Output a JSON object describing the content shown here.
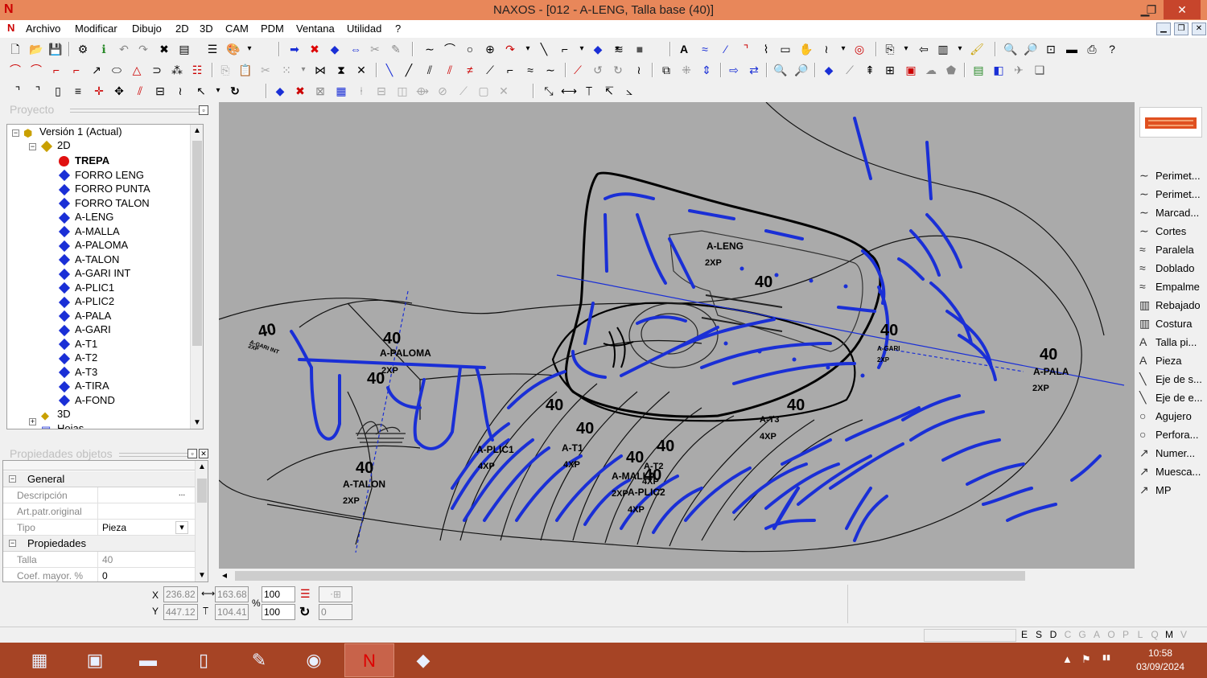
{
  "window": {
    "title": "NAXOS - [012 - A-LENG, Talla base (40)]",
    "app_icon": "N",
    "controls": {
      "minimize": "▁",
      "maximize": "❐",
      "close": "✕"
    }
  },
  "menu": {
    "items": [
      "Archivo",
      "Modificar",
      "Dibujo",
      "2D",
      "3D",
      "CAM",
      "PDM",
      "Ventana",
      "Utilidad",
      "?"
    ],
    "mdi_controls": [
      "▁",
      "❐",
      "✕"
    ]
  },
  "project_panel": {
    "title": "Proyecto",
    "root": "Versión 1 (Actual)",
    "node_2d": "2D",
    "items": [
      {
        "label": "TREPA",
        "bold": true,
        "color": "#e01010"
      },
      {
        "label": "FORRO LENG"
      },
      {
        "label": "FORRO PUNTA"
      },
      {
        "label": "FORRO TALON"
      },
      {
        "label": "A-LENG"
      },
      {
        "label": "A-MALLA"
      },
      {
        "label": "A-PALOMA"
      },
      {
        "label": "A-TALON"
      },
      {
        "label": "A-GARI INT"
      },
      {
        "label": "A-PLIC1"
      },
      {
        "label": "A-PLIC2"
      },
      {
        "label": "A-PALA"
      },
      {
        "label": "A-GARI"
      },
      {
        "label": "A-T1"
      },
      {
        "label": "A-T2"
      },
      {
        "label": "A-T3"
      },
      {
        "label": "A-TIRA"
      },
      {
        "label": "A-FOND"
      }
    ],
    "node_3d": "3D",
    "node_hojas": "Hojas"
  },
  "properties_panel": {
    "title": "Propiedades objetos",
    "groups": [
      {
        "name": "General",
        "rows": [
          {
            "key": "Descripción",
            "value": "",
            "button": "..."
          },
          {
            "key": "Art.patr.original",
            "value": ""
          },
          {
            "key": "Tipo",
            "value": "Pieza",
            "dropdown": "▾"
          }
        ]
      },
      {
        "name": "Propiedades",
        "rows": [
          {
            "key": "Talla",
            "value": "40"
          },
          {
            "key": "Coef. mayor. %",
            "value": "0"
          }
        ]
      }
    ]
  },
  "canvas_labels": [
    {
      "name": "A-LENG",
      "sub": "2XP",
      "size": "40"
    },
    {
      "name": "A-PALOMA",
      "sub": "2XP",
      "size": "40"
    },
    {
      "name": "A-TALON",
      "sub": "2XP",
      "size": "40"
    },
    {
      "name": "A-PLIC1",
      "sub": "4XP",
      "size": "40"
    },
    {
      "name": "A-T1",
      "sub": "4XP",
      "size": "40"
    },
    {
      "name": "A-MALLA",
      "sub": "2XP",
      "size": "40"
    },
    {
      "name": "A-PLIC2",
      "sub": "4XP",
      "size": "40"
    },
    {
      "name": "A-T2",
      "sub": "4XP",
      "size": "40"
    },
    {
      "name": "A-T3",
      "sub": "4XP",
      "size": "40"
    },
    {
      "name": "A-GARI",
      "sub": "2XP",
      "size": "40"
    },
    {
      "name": "A-PALA",
      "sub": "2XP",
      "size": "40"
    },
    {
      "name": "A-GARI INT",
      "sub": "2XP",
      "size": "40"
    }
  ],
  "right_tools": [
    {
      "icon": "curve-icon",
      "glyph": "∼",
      "label": "Perimet..."
    },
    {
      "icon": "curve-icon",
      "glyph": "∼",
      "label": "Perimet..."
    },
    {
      "icon": "curve-icon",
      "glyph": "∼",
      "label": "Marcad..."
    },
    {
      "icon": "curve-icon",
      "glyph": "∼",
      "label": "Cortes"
    },
    {
      "icon": "parallel-icon",
      "glyph": "≈",
      "label": "Paralela"
    },
    {
      "icon": "fold-icon",
      "glyph": "≈",
      "label": "Doblado"
    },
    {
      "icon": "join-icon",
      "glyph": "≈",
      "label": "Empalme"
    },
    {
      "icon": "skive-icon",
      "glyph": "▥",
      "label": "Rebajado"
    },
    {
      "icon": "stitch-icon",
      "glyph": "▥",
      "label": "Costura"
    },
    {
      "icon": "text-icon",
      "glyph": "A",
      "label": "Talla pi..."
    },
    {
      "icon": "text-icon",
      "glyph": "A",
      "label": "Pieza"
    },
    {
      "icon": "axis-icon",
      "glyph": "╲",
      "label": "Eje de s..."
    },
    {
      "icon": "axis-icon",
      "glyph": "╲",
      "label": "Eje de e..."
    },
    {
      "icon": "hole-icon",
      "glyph": "○",
      "label": "Agujero"
    },
    {
      "icon": "punch-icon",
      "glyph": "○",
      "label": "Perfora..."
    },
    {
      "icon": "number-icon",
      "glyph": "↗",
      "label": "Numer..."
    },
    {
      "icon": "notch-icon",
      "glyph": "↗",
      "label": "Muesca..."
    },
    {
      "icon": "mp-icon",
      "glyph": "↗",
      "label": "MP"
    }
  ],
  "coords": {
    "x_label": "X",
    "y_label": "Y",
    "x": "236.82",
    "y": "447.12",
    "width": "163.68",
    "height": "104.41",
    "scale_x": "100",
    "scale_y": "100",
    "percent": "%",
    "angle": "0"
  },
  "status_flags": [
    {
      "label": "E",
      "on": true
    },
    {
      "label": "S",
      "on": true
    },
    {
      "label": "D",
      "on": true
    },
    {
      "label": "C",
      "on": false
    },
    {
      "label": "G",
      "on": false
    },
    {
      "label": "A",
      "on": false
    },
    {
      "label": "O",
      "on": false
    },
    {
      "label": "P",
      "on": false
    },
    {
      "label": "L",
      "on": false
    },
    {
      "label": "Q",
      "on": false
    },
    {
      "label": "M",
      "on": true
    },
    {
      "label": "V",
      "on": false
    }
  ],
  "taskbar": {
    "apps": [
      {
        "icon": "calculator-icon",
        "glyph": "▦"
      },
      {
        "icon": "explorer-window-icon",
        "glyph": "▣"
      },
      {
        "icon": "folder-icon",
        "glyph": "▬"
      },
      {
        "icon": "document-icon",
        "glyph": "▯"
      },
      {
        "icon": "green-app-icon",
        "glyph": "✎"
      },
      {
        "icon": "chrome-icon",
        "glyph": "◉"
      },
      {
        "icon": "naxos-icon",
        "glyph": "N"
      },
      {
        "icon": "eraser-app-icon",
        "glyph": "◆"
      }
    ],
    "time": "10:58",
    "date": "03/09/2024",
    "tray": [
      "▲",
      "⚑",
      "▮▮"
    ]
  }
}
